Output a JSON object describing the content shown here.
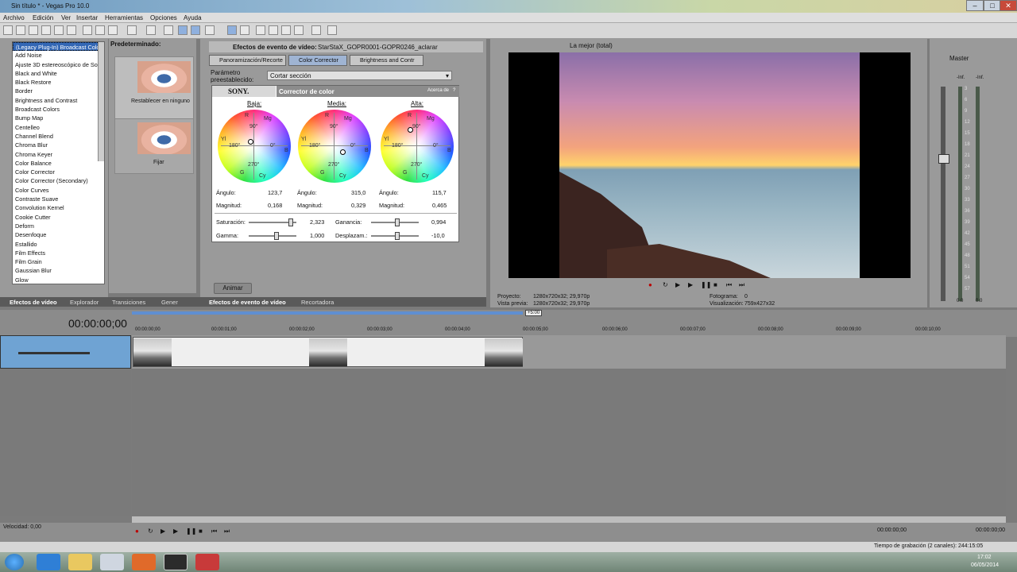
{
  "window": {
    "title": "Sin título * - Vegas Pro 10.0",
    "minimize": "–",
    "maximize": "□",
    "close": "✕"
  },
  "menu": [
    "Archivo",
    "Edición",
    "Ver",
    "Insertar",
    "Herramientas",
    "Opciones",
    "Ayuda"
  ],
  "left_panel": {
    "preset_header": "Predeterminado:",
    "selected_item": "(Legacy Plug-In) Broadcast Colo",
    "items": [
      "Add Noise",
      "Ajuste 3D estereoscópico de So",
      "Black and White",
      "Black Restore",
      "Border",
      "Brightness and Contrast",
      "Broadcast Colors",
      "Bump Map",
      "Centelleo",
      "Channel Blend",
      "Chroma Blur",
      "Chroma Keyer",
      "Color Balance",
      "Color Corrector",
      "Color Corrector (Secondary)",
      "Color Curves",
      "Contraste Suave",
      "Convolution Kernel",
      "Cookie Cutter",
      "Deform",
      "Desenfoque",
      "Estallido",
      "Film Effects",
      "Film Grain",
      "Gaussian Blur",
      "Glow"
    ],
    "presets": [
      "Restablecer en ninguno",
      "Fijar"
    ],
    "tabs": [
      "Efectos de vídeo",
      "Explorador",
      "Transiciones",
      "Gener"
    ]
  },
  "fx_window": {
    "header_label": "Efectos de evento de vídeo:",
    "header_value": "StarStaX_GOPR0001-GOPR0246_aclarar",
    "chain": [
      "Panoramización/Recorte",
      "Color Corrector",
      "Brightness and Contr"
    ],
    "preset_label_1": "Parámetro",
    "preset_label_2": "preestablecido:",
    "preset_value": "Cortar sección",
    "plugin_brand": "SONY.",
    "plugin_name": "Corrector de color",
    "about": "Acerca de",
    "help": "?",
    "wheels": [
      {
        "label": "Baja:",
        "angle": "123,7",
        "magnitude": "0,168"
      },
      {
        "label": "Media:",
        "angle": "315,0",
        "magnitude": "0,329"
      },
      {
        "label": "Alta:",
        "angle": "115,7",
        "magnitude": "0,465"
      }
    ],
    "wheel_marks": {
      "r": "R",
      "mg": "Mg",
      "b": "B",
      "cy": "Cy",
      "g": "G",
      "yl": "Yl",
      "d90": "90°",
      "d0": "0°",
      "d180": "180°",
      "d270": "270°"
    },
    "angle_label": "Ángulo:",
    "magnitude_label": "Magnitud:",
    "saturation_label": "Saturación:",
    "saturation": "2,323",
    "gain_label": "Ganancia:",
    "gain": "0,994",
    "gamma_label": "Gamma:",
    "gamma": "1,000",
    "offset_label": "Desplazam.:",
    "offset": "-10,0",
    "animate": "Animar",
    "tabs": [
      "Efectos de evento de vídeo",
      "Recortadora"
    ]
  },
  "preview": {
    "quality": "La mejor (total)",
    "project_label": "Proyecto:",
    "project": "1280x720x32; 29,970p",
    "preview_label": "Vista previa:",
    "preview": "1280x720x32; 29,970p",
    "frame_label": "Fotograma:",
    "frame": "0",
    "display_label": "Visualización:",
    "display": "759x427x32"
  },
  "mixer": {
    "master": "Master",
    "inf": "-Inf.",
    "inf2": "-Inf.",
    "scale": [
      "3",
      "6",
      "9",
      "12",
      "15",
      "18",
      "21",
      "24",
      "27",
      "30",
      "33",
      "36",
      "39",
      "42",
      "45",
      "48",
      "51",
      "54",
      "57"
    ],
    "left_val": "0.0",
    "right_val": "0.0"
  },
  "timeline": {
    "timecode": "00:00:00;00",
    "rate_marker": "+5:00",
    "ticks": [
      "00:00:00;00",
      "00:00:01;00",
      "00:00:02;00",
      "00:00:03;00",
      "00:00:04;00",
      "00:00:05;00",
      "00:00:06;00",
      "00:00:07;00",
      "00:00:08;00",
      "00:00:09;00",
      "00:00:10;00"
    ],
    "speed": "Velocidad: 0,00",
    "end_time": "00:00:00;00",
    "end_time2": "00:00:00;00",
    "record_status": "Tiempo de grabación (2 canales): 244:15:05"
  },
  "taskbar": {
    "time": "17:02",
    "date": "06/05/2014"
  }
}
